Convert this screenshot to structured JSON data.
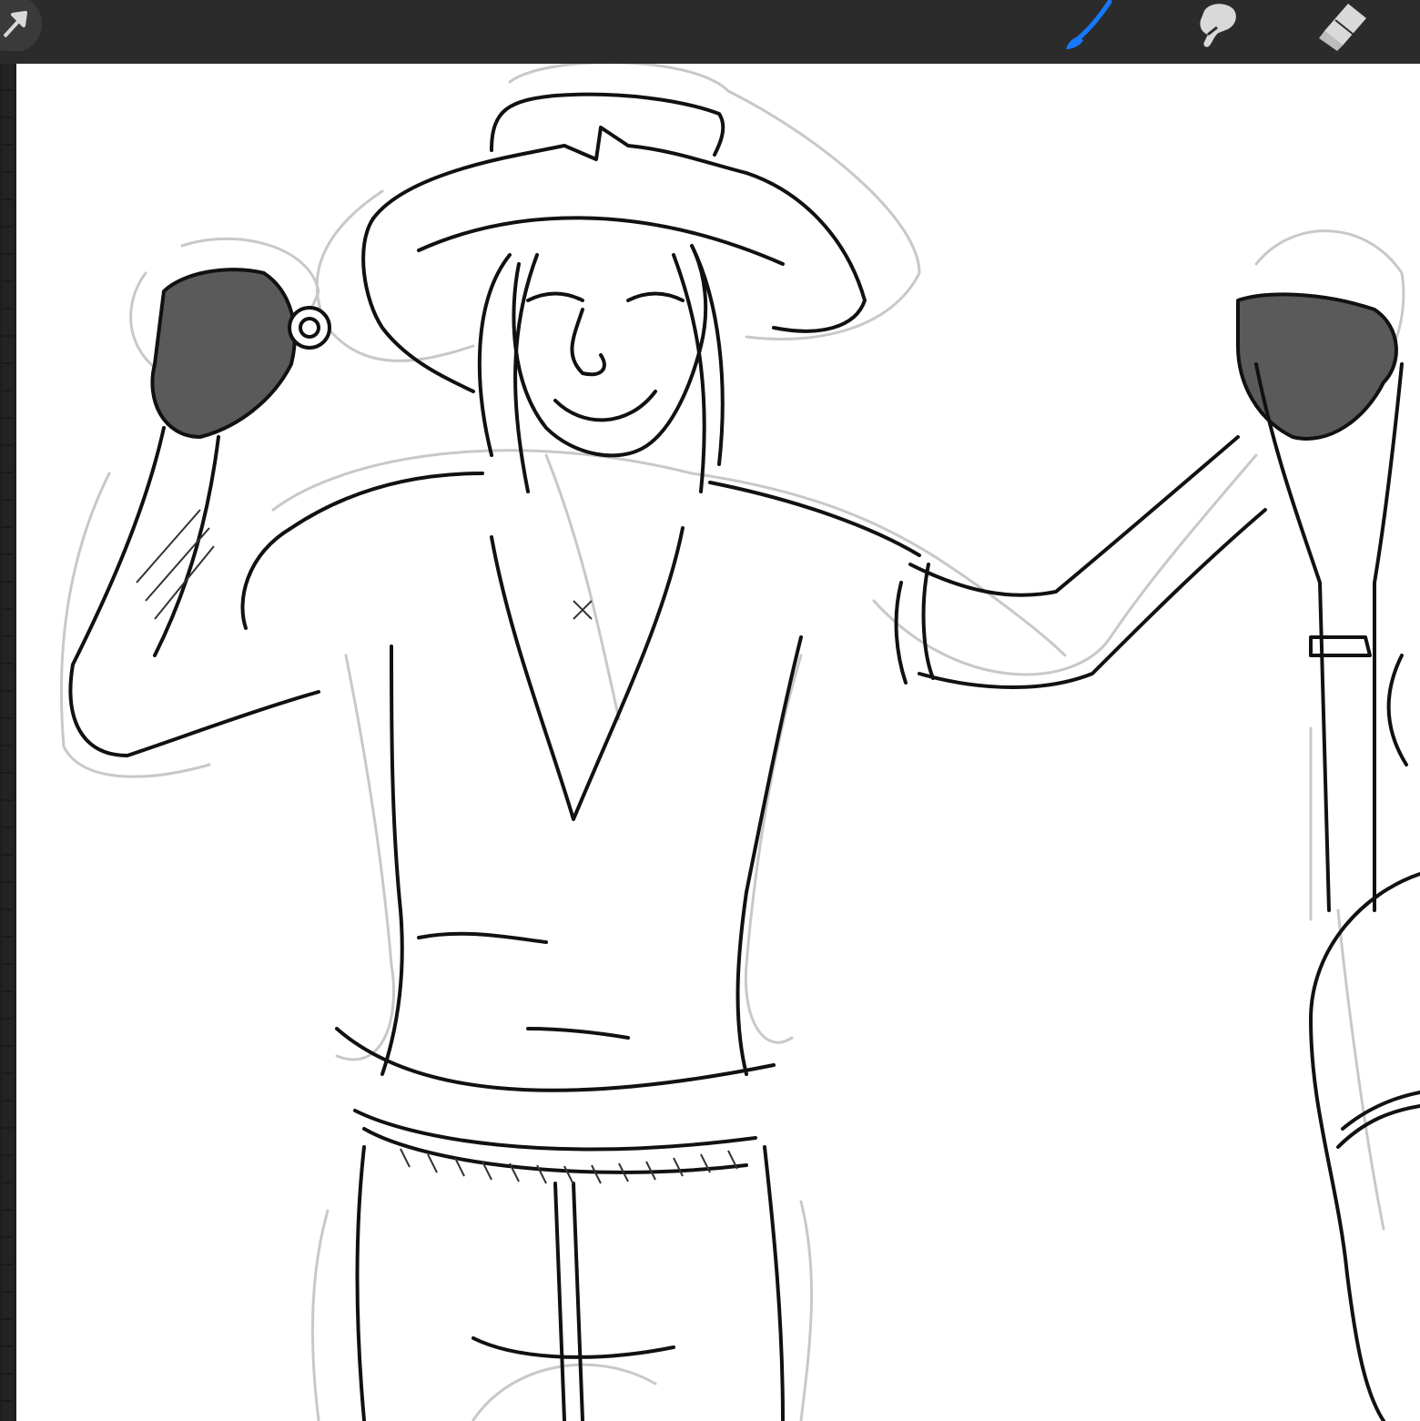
{
  "app": {
    "name": ""
  },
  "toolbar": {
    "tools": [
      {
        "id": "transform",
        "icon": "arrow-cursor-icon",
        "active": false
      },
      {
        "id": "brush",
        "icon": "brush-icon",
        "active": true,
        "color": "#1677ff"
      },
      {
        "id": "smudge",
        "icon": "smudge-finger-icon",
        "active": false
      },
      {
        "id": "eraser",
        "icon": "eraser-icon",
        "active": false
      }
    ]
  },
  "canvas": {
    "content": "figure-sketch",
    "background": "#ffffff",
    "ink": "#111111",
    "sketch_lines": "#c8c8c8",
    "shading": "#5a5a5a"
  },
  "colors": {
    "chrome": "#2b2b2b",
    "accent": "#1677ff",
    "icon": "#d9d9d9"
  }
}
